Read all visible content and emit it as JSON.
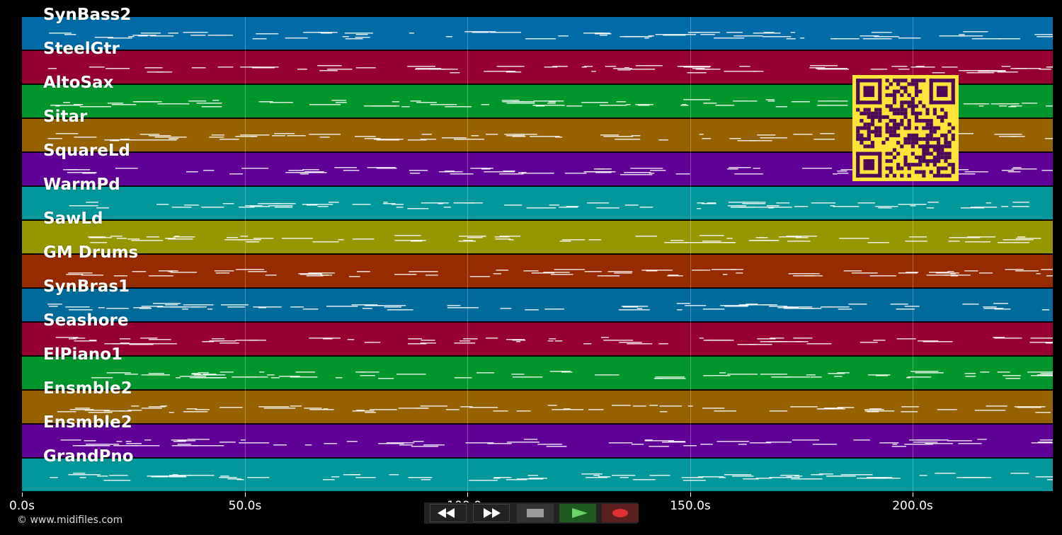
{
  "timeline": {
    "max_seconds": 231.3,
    "ticks": [
      {
        "value": 0,
        "label": "0.0s"
      },
      {
        "value": 50,
        "label": "50.0s"
      },
      {
        "value": 100,
        "label": "100.0s"
      },
      {
        "value": 150,
        "label": "150.0s"
      },
      {
        "value": 200,
        "label": "200.0s"
      }
    ]
  },
  "tracks": [
    {
      "name": "SynBass2",
      "color": "#006ba6"
    },
    {
      "name": "SteelGtr",
      "color": "#960031"
    },
    {
      "name": "AltoSax",
      "color": "#00962b"
    },
    {
      "name": "Sitar",
      "color": "#966200"
    },
    {
      "name": "SquareLd",
      "color": "#600096"
    },
    {
      "name": "WarmPd",
      "color": "#00969a"
    },
    {
      "name": "SawLd",
      "color": "#969600"
    },
    {
      "name": "GM Drums",
      "color": "#962b00"
    },
    {
      "name": "SynBras1",
      "color": "#006b9a"
    },
    {
      "name": "Seashore",
      "color": "#960031"
    },
    {
      "name": "ElPiano1",
      "color": "#00962b"
    },
    {
      "name": "Ensmble2",
      "color": "#966200"
    },
    {
      "name": "Ensmble2",
      "color": "#600096"
    },
    {
      "name": "GrandPno",
      "color": "#00969a"
    }
  ],
  "footer": {
    "copyright": "© www.midifiles.com"
  },
  "transport": {
    "buttons": [
      {
        "name": "rewind-icon",
        "fg": "#ffffff",
        "bg": "#111111"
      },
      {
        "name": "fast-forward-icon",
        "fg": "#ffffff",
        "bg": "#111111"
      },
      {
        "name": "stop-icon",
        "fg": "#999999",
        "bg": "#333333"
      },
      {
        "name": "play-icon",
        "fg": "#5fd35f",
        "bg": "#1f5a1f"
      },
      {
        "name": "record-icon",
        "fg": "#e03030",
        "bg": "#5a1f1f"
      }
    ]
  },
  "qr_color": "#4b0a5a"
}
